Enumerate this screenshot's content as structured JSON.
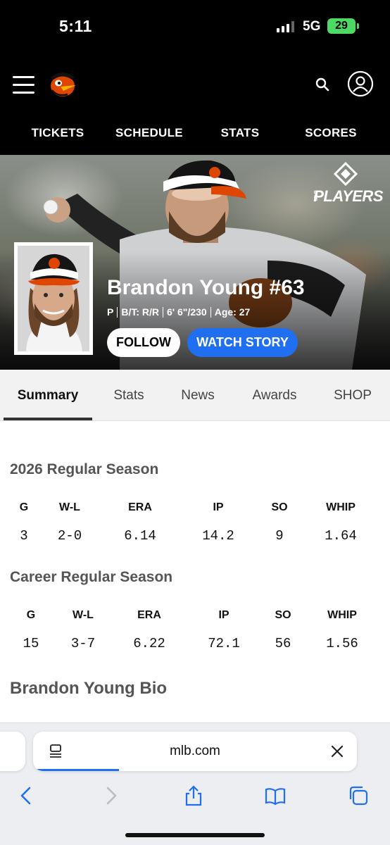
{
  "status_bar": {
    "time": "5:11",
    "network": "5G",
    "battery": "29"
  },
  "nav": {
    "items": [
      "TICKETS",
      "SCHEDULE",
      "STATS",
      "SCORES"
    ]
  },
  "hero": {
    "badge": "PLAYERS",
    "badge_prefix": "MLB",
    "player_name": "Brandon Young #63",
    "position": "P",
    "bats_throws": "B/T: R/R",
    "height_weight": "6' 6\"/230",
    "age": "Age: 27",
    "follow_label": "FOLLOW",
    "watch_label": "WATCH STORY"
  },
  "tabs": {
    "items": [
      "Summary",
      "Stats",
      "News",
      "Awards",
      "SHOP"
    ],
    "active": "Summary"
  },
  "current_season": {
    "title": "2026 Regular Season",
    "headers": [
      "G",
      "W-L",
      "ERA",
      "IP",
      "SO",
      "WHIP"
    ],
    "values": [
      "3",
      "2-0",
      "6.14",
      "14.2",
      "9",
      "1.64"
    ]
  },
  "career": {
    "title": "Career Regular Season",
    "headers": [
      "G",
      "W-L",
      "ERA",
      "IP",
      "SO",
      "WHIP"
    ],
    "values": [
      "15",
      "3-7",
      "6.22",
      "72.1",
      "56",
      "1.56"
    ]
  },
  "bio": {
    "title": "Brandon Young Bio"
  },
  "browser": {
    "url": "mlb.com"
  },
  "colors": {
    "accent_blue": "#1f6ff0",
    "orioles_orange": "#df4601",
    "battery_green": "#4cd964"
  }
}
